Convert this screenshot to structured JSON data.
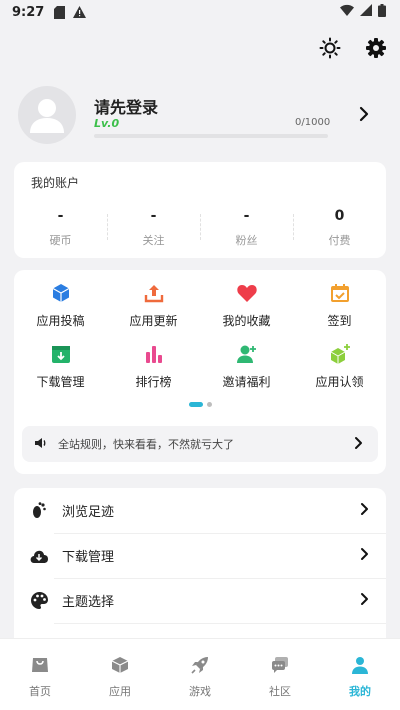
{
  "status_bar": {
    "time": "9:27"
  },
  "profile": {
    "login_prompt": "请先登录",
    "level": "Lv.0",
    "exp_text": "0/1000",
    "exp_progress": 0
  },
  "account": {
    "title": "我的账户",
    "stats": [
      {
        "value": "-",
        "label": "硬币"
      },
      {
        "value": "-",
        "label": "关注"
      },
      {
        "value": "-",
        "label": "粉丝"
      },
      {
        "value": "0",
        "label": "付费"
      }
    ]
  },
  "features": {
    "items": [
      {
        "label": "应用投稿",
        "icon": "cube-icon",
        "color": "#2a7de1"
      },
      {
        "label": "应用更新",
        "icon": "upload-icon",
        "color": "#ef6a3c"
      },
      {
        "label": "我的收藏",
        "icon": "heart-icon",
        "color": "#ee3d4a"
      },
      {
        "label": "签到",
        "icon": "calendar-check-icon",
        "color": "#f2a02e"
      },
      {
        "label": "下载管理",
        "icon": "download-box-icon",
        "color": "#23b36a"
      },
      {
        "label": "排行榜",
        "icon": "bar-chart-icon",
        "color": "#e94a8f"
      },
      {
        "label": "邀请福利",
        "icon": "add-user-icon",
        "color": "#2fb873"
      },
      {
        "label": "应用认领",
        "icon": "cube-plus-icon",
        "color": "#8ccf3c"
      }
    ],
    "page_count": 2,
    "active_page": 0
  },
  "notice": {
    "text": "全站规则，快来看看，不然就亏大了"
  },
  "menu": {
    "items": [
      {
        "label": "浏览足迹",
        "icon": "footprint-icon"
      },
      {
        "label": "下载管理",
        "icon": "cloud-download-icon"
      },
      {
        "label": "主题选择",
        "icon": "palette-icon"
      }
    ]
  },
  "tabs": [
    {
      "label": "首页",
      "icon": "home-bag-icon",
      "active": false
    },
    {
      "label": "应用",
      "icon": "box-icon",
      "active": false
    },
    {
      "label": "游戏",
      "icon": "rocket-icon",
      "active": false
    },
    {
      "label": "社区",
      "icon": "chat-icon",
      "active": false
    },
    {
      "label": "我的",
      "icon": "person-icon",
      "active": true
    }
  ],
  "colors": {
    "accent": "#2bb6d6",
    "level_green": "#3cbf4a"
  }
}
